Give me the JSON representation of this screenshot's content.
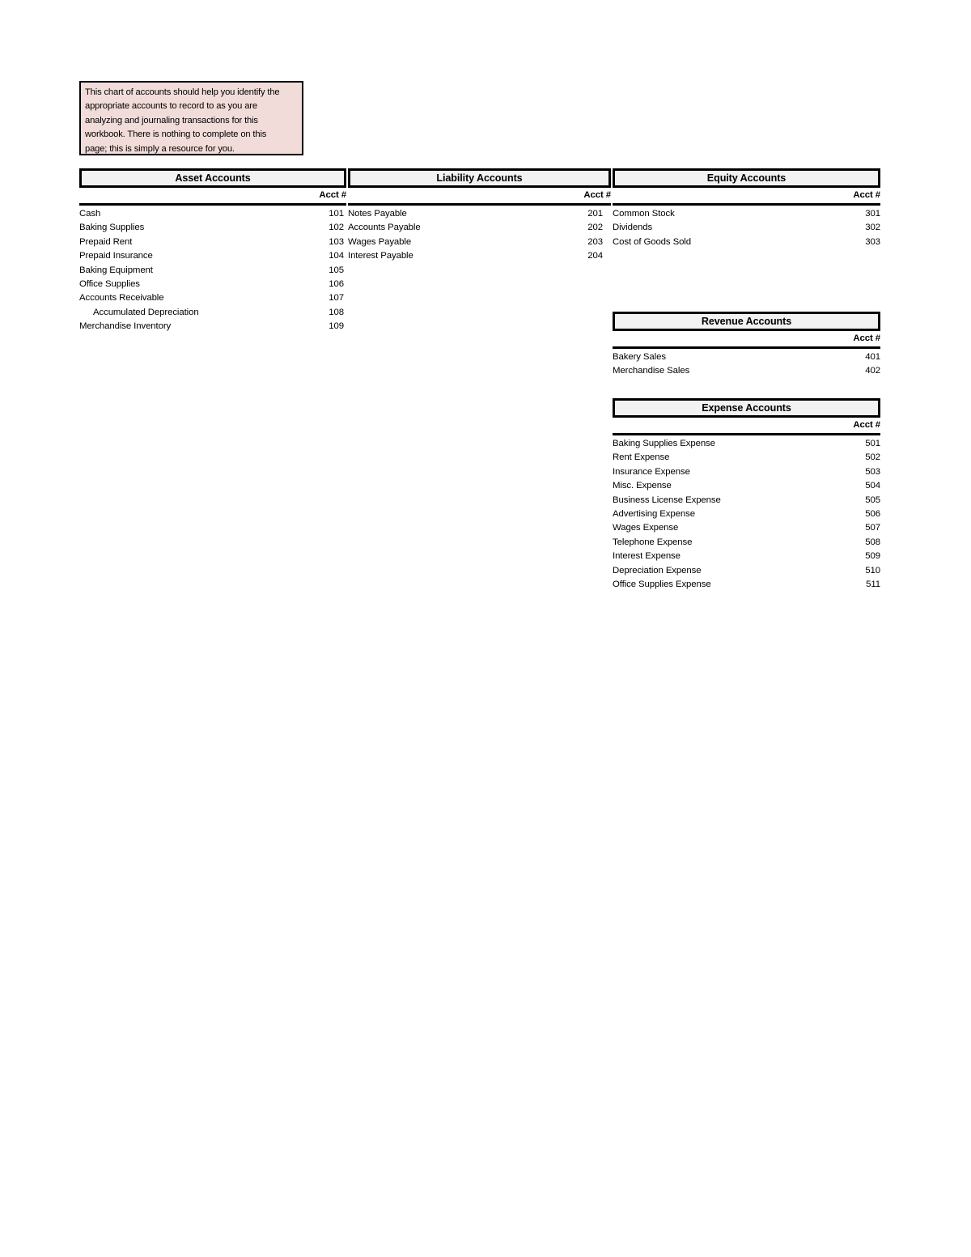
{
  "note": {
    "lines": [
      "This chart of accounts should help you identify the",
      "appropriate accounts to record to as you are",
      "analyzing and journaling transactions for this",
      "workbook. There is nothing to complete on this",
      "page; this is simply a resource for you."
    ]
  },
  "acct_header_label": "Acct #",
  "colors": {
    "note_background": "#f2dcd9",
    "header_background": "#f2f2f2",
    "border": "#000000",
    "text": "#000000",
    "page_background": "#ffffff"
  },
  "blocks": {
    "asset": {
      "title": "Asset Accounts",
      "acct_label": "Acct #",
      "rows": [
        {
          "name": "Cash",
          "num": "101",
          "indented": false
        },
        {
          "name": "Baking Supplies",
          "num": "102",
          "indented": false
        },
        {
          "name": "Prepaid Rent",
          "num": "103",
          "indented": false
        },
        {
          "name": "Prepaid Insurance",
          "num": "104",
          "indented": false
        },
        {
          "name": "Baking Equipment",
          "num": "105",
          "indented": false
        },
        {
          "name": "Office Supplies",
          "num": "106",
          "indented": false
        },
        {
          "name": "Accounts Receivable",
          "num": "107",
          "indented": false
        },
        {
          "name": "Accumulated Depreciation",
          "num": "108",
          "indented": true
        },
        {
          "name": "Merchandise Inventory",
          "num": "109",
          "indented": false
        }
      ]
    },
    "liability": {
      "title": "Liability Accounts",
      "acct_label": "Acct #",
      "rows": [
        {
          "name": "Notes Payable",
          "num": "201",
          "indented": false
        },
        {
          "name": "Accounts Payable",
          "num": "202",
          "indented": false
        },
        {
          "name": "Wages Payable",
          "num": "203",
          "indented": false
        },
        {
          "name": "Interest Payable",
          "num": "204",
          "indented": false
        }
      ]
    },
    "equity": {
      "title": "Equity Accounts",
      "acct_label": "Acct #",
      "rows": [
        {
          "name": "Common Stock",
          "num": "301",
          "indented": false
        },
        {
          "name": "Dividends",
          "num": "302",
          "indented": false
        },
        {
          "name": "Cost of Goods Sold",
          "num": "303",
          "indented": false
        }
      ]
    },
    "revenue": {
      "title": "Revenue Accounts",
      "acct_label": "Acct #",
      "rows": [
        {
          "name": "Bakery Sales",
          "num": "401",
          "indented": false
        },
        {
          "name": "Merchandise Sales",
          "num": "402",
          "indented": false
        }
      ]
    },
    "expense": {
      "title": "Expense Accounts",
      "acct_label": "Acct #",
      "rows": [
        {
          "name": "Baking Supplies Expense",
          "num": "501",
          "indented": false
        },
        {
          "name": "Rent Expense",
          "num": "502",
          "indented": false
        },
        {
          "name": "Insurance Expense",
          "num": "503",
          "indented": false
        },
        {
          "name": "Misc. Expense",
          "num": "504",
          "indented": false
        },
        {
          "name": "Business License Expense",
          "num": "505",
          "indented": false
        },
        {
          "name": "Advertising Expense",
          "num": "506",
          "indented": false
        },
        {
          "name": "Wages Expense",
          "num": "507",
          "indented": false
        },
        {
          "name": "Telephone Expense",
          "num": "508",
          "indented": false
        },
        {
          "name": "Interest Expense",
          "num": "509",
          "indented": false
        },
        {
          "name": "Depreciation Expense",
          "num": "510",
          "indented": false
        },
        {
          "name": "Office Supplies Expense",
          "num": "511",
          "indented": false
        }
      ]
    }
  }
}
